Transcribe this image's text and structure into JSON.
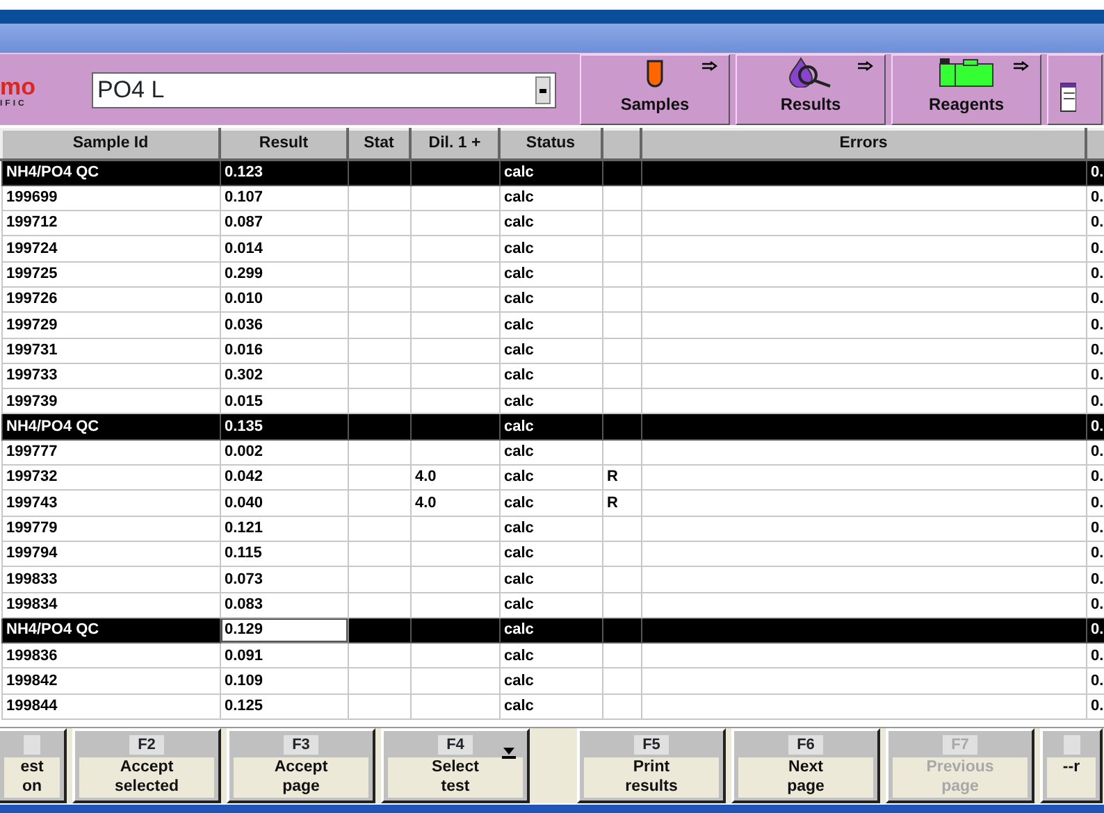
{
  "logo": {
    "line_1": "mo",
    "line_2": "IFIC"
  },
  "test_select": {
    "value": "PO4 L"
  },
  "nav_buttons": [
    {
      "label": "Samples",
      "kind": "tube"
    },
    {
      "label": "Results",
      "kind": "drop"
    },
    {
      "label": "Reagents",
      "kind": "folder"
    },
    {
      "kind": "sheet"
    }
  ],
  "table": {
    "columns": [
      "Sample Id",
      "Result",
      "Stat",
      "Dil. 1 +",
      "Status",
      "",
      "Errors",
      ""
    ],
    "rows": [
      {
        "kind": "qc",
        "focused": false,
        "cells": [
          "NH4/PO4 QC",
          "0.123",
          "",
          "",
          "calc",
          "",
          "",
          "0."
        ]
      },
      {
        "kind": "sample",
        "focused": false,
        "cells": [
          "199699",
          "0.107",
          "",
          "",
          "calc",
          "",
          "",
          "0."
        ]
      },
      {
        "kind": "sample",
        "focused": false,
        "cells": [
          "199712",
          "0.087",
          "",
          "",
          "calc",
          "",
          "",
          "0."
        ]
      },
      {
        "kind": "sample",
        "focused": false,
        "cells": [
          "199724",
          "0.014",
          "",
          "",
          "calc",
          "",
          "",
          "0."
        ]
      },
      {
        "kind": "sample",
        "focused": false,
        "cells": [
          "199725",
          "0.299",
          "",
          "",
          "calc",
          "",
          "",
          "0."
        ]
      },
      {
        "kind": "sample",
        "focused": false,
        "cells": [
          "199726",
          "0.010",
          "",
          "",
          "calc",
          "",
          "",
          "0."
        ]
      },
      {
        "kind": "sample",
        "focused": false,
        "cells": [
          "199729",
          "0.036",
          "",
          "",
          "calc",
          "",
          "",
          "0."
        ]
      },
      {
        "kind": "sample",
        "focused": false,
        "cells": [
          "199731",
          "0.016",
          "",
          "",
          "calc",
          "",
          "",
          "0."
        ]
      },
      {
        "kind": "sample",
        "focused": false,
        "cells": [
          "199733",
          "0.302",
          "",
          "",
          "calc",
          "",
          "",
          "0."
        ]
      },
      {
        "kind": "sample",
        "focused": false,
        "cells": [
          "199739",
          "0.015",
          "",
          "",
          "calc",
          "",
          "",
          "0."
        ]
      },
      {
        "kind": "qc",
        "focused": false,
        "cells": [
          "NH4/PO4 QC",
          "0.135",
          "",
          "",
          "calc",
          "",
          "",
          "0."
        ]
      },
      {
        "kind": "sample",
        "focused": false,
        "cells": [
          "199777",
          "0.002",
          "",
          "",
          "calc",
          "",
          "",
          "0."
        ]
      },
      {
        "kind": "sample",
        "focused": false,
        "cells": [
          "199732",
          "0.042",
          "",
          "4.0",
          "calc",
          "R",
          "",
          "0."
        ]
      },
      {
        "kind": "sample",
        "focused": false,
        "cells": [
          "199743",
          "0.040",
          "",
          "4.0",
          "calc",
          "R",
          "",
          "0."
        ]
      },
      {
        "kind": "sample",
        "focused": false,
        "cells": [
          "199779",
          "0.121",
          "",
          "",
          "calc",
          "",
          "",
          "0."
        ]
      },
      {
        "kind": "sample",
        "focused": false,
        "cells": [
          "199794",
          "0.115",
          "",
          "",
          "calc",
          "",
          "",
          "0."
        ]
      },
      {
        "kind": "sample",
        "focused": false,
        "cells": [
          "199833",
          "0.073",
          "",
          "",
          "calc",
          "",
          "",
          "0."
        ]
      },
      {
        "kind": "sample",
        "focused": false,
        "cells": [
          "199834",
          "0.083",
          "",
          "",
          "calc",
          "",
          "",
          "0."
        ]
      },
      {
        "kind": "qc",
        "focused": true,
        "cells": [
          "NH4/PO4 QC",
          "0.129",
          "",
          "",
          "calc",
          "",
          "",
          "0."
        ]
      },
      {
        "kind": "sample",
        "focused": false,
        "cells": [
          "199836",
          "0.091",
          "",
          "",
          "calc",
          "",
          "",
          "0."
        ]
      },
      {
        "kind": "sample",
        "focused": false,
        "cells": [
          "199842",
          "0.109",
          "",
          "",
          "calc",
          "",
          "",
          "0."
        ]
      },
      {
        "kind": "sample",
        "focused": false,
        "cells": [
          "199844",
          "0.125",
          "",
          "",
          "calc",
          "",
          "",
          "0."
        ]
      }
    ]
  },
  "function_keys": [
    {
      "label": "est\non",
      "disabled": false,
      "dropdown": false
    },
    {
      "key": "F2",
      "label": "Accept\nselected",
      "disabled": false,
      "dropdown": false
    },
    {
      "key": "F3",
      "label": "Accept\npage",
      "disabled": false,
      "dropdown": false
    },
    {
      "key": "F4",
      "label": "Select\ntest",
      "disabled": false,
      "dropdown": true
    },
    {
      "key": "F5",
      "label": "Print\nresults",
      "disabled": false,
      "dropdown": false
    },
    {
      "key": "F6",
      "label": "Next\npage",
      "disabled": false,
      "dropdown": false
    },
    {
      "key": "F7",
      "label": "Previous\npage",
      "disabled": true,
      "dropdown": false
    },
    {
      "label": "--r",
      "disabled": false,
      "dropdown": false
    }
  ]
}
